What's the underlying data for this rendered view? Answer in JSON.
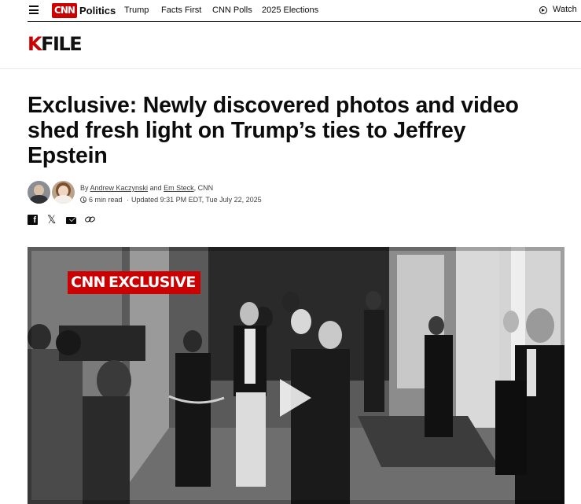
{
  "header": {
    "logo_text": "CNN",
    "section": "Politics",
    "nav_links": [
      "Trump",
      "Facts First",
      "CNN Polls",
      "2025 Elections"
    ],
    "watch_label": "Watch"
  },
  "brand": {
    "k": "K",
    "rest": "FILE",
    "accent_color": "#cc0000"
  },
  "article": {
    "headline": "Exclusive: Newly discovered photos and video shed fresh light on Trump’s ties to Jeffrey Epstein",
    "byline_prefix": "By",
    "authors": [
      "Andrew Kaczynski",
      "Em Steck"
    ],
    "byline_and": "and",
    "byline_suffix": ", CNN",
    "read_time": "6 min read",
    "updated": "Updated 9:31 PM EDT, Tue July 22, 2025"
  },
  "share": {
    "icons": [
      "facebook-icon",
      "x-icon",
      "email-icon",
      "link-icon"
    ]
  },
  "video": {
    "badge_cnn": "CNN",
    "badge_label": "EXCLUSIVE"
  }
}
